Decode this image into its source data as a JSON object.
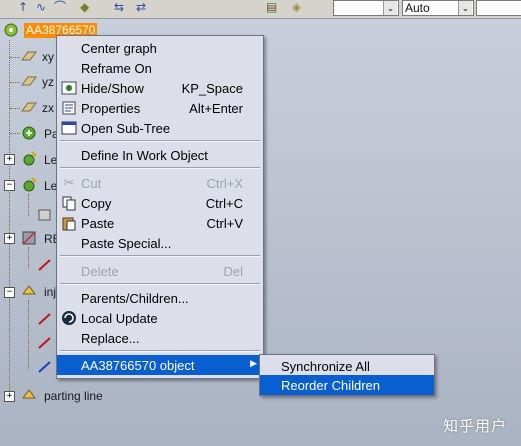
{
  "toolbar": {
    "combo_empty_value": "",
    "combo_auto_value": "Auto"
  },
  "tree": {
    "root_label": "AA38766570",
    "items": [
      {
        "label": "xy",
        "icon": "plane-icon"
      },
      {
        "label": "yz",
        "icon": "plane-icon"
      },
      {
        "label": "zx",
        "icon": "plane-icon"
      },
      {
        "label": "Pa",
        "icon": "part-body-icon"
      },
      {
        "label": "Le",
        "icon": "geometric-set-icon"
      },
      {
        "label": "Le",
        "icon": "geometric-set-icon"
      },
      {
        "label": "RE",
        "icon": "reference-icon"
      },
      {
        "label": "inj",
        "icon": "geometric-set-icon"
      },
      {
        "label": "parting line",
        "icon": "geometric-set-icon"
      }
    ]
  },
  "context_menu": {
    "items": [
      {
        "label": "Center graph",
        "shortcut": "",
        "icon": "",
        "enabled": true
      },
      {
        "label": "Reframe On",
        "shortcut": "",
        "icon": "",
        "enabled": true
      },
      {
        "label": "Hide/Show",
        "shortcut": "KP_Space",
        "icon": "hide-show-icon",
        "enabled": true
      },
      {
        "label": "Properties",
        "shortcut": "Alt+Enter",
        "icon": "properties-icon",
        "enabled": true
      },
      {
        "label": "Open Sub-Tree",
        "shortcut": "",
        "icon": "open-subtree-icon",
        "enabled": true
      },
      {
        "label": "Define In Work Object",
        "shortcut": "",
        "icon": "",
        "enabled": true
      },
      {
        "label": "Cut",
        "shortcut": "Ctrl+X",
        "icon": "scissors-icon",
        "enabled": false
      },
      {
        "label": "Copy",
        "shortcut": "Ctrl+C",
        "icon": "copy-icon",
        "enabled": true
      },
      {
        "label": "Paste",
        "shortcut": "Ctrl+V",
        "icon": "paste-icon",
        "enabled": true
      },
      {
        "label": "Paste Special...",
        "shortcut": "",
        "icon": "",
        "enabled": true
      },
      {
        "label": "Delete",
        "shortcut": "Del",
        "icon": "",
        "enabled": false
      },
      {
        "label": "Parents/Children...",
        "shortcut": "",
        "icon": "",
        "enabled": true
      },
      {
        "label": "Local Update",
        "shortcut": "",
        "icon": "update-icon",
        "enabled": true
      },
      {
        "label": "Replace...",
        "shortcut": "",
        "icon": "",
        "enabled": true
      },
      {
        "label": "AA38766570 object",
        "shortcut": "",
        "icon": "",
        "enabled": true,
        "highlighted": true
      }
    ]
  },
  "submenu": {
    "items": [
      {
        "label": "Synchronize All",
        "highlighted": false
      },
      {
        "label": "Reorder Children",
        "highlighted": true
      }
    ]
  },
  "watermark": "知乎用户",
  "colors": {
    "selection": "#0a5fd0",
    "root_highlight": "#ff8c00",
    "menu_background": "#dcdfe9"
  }
}
